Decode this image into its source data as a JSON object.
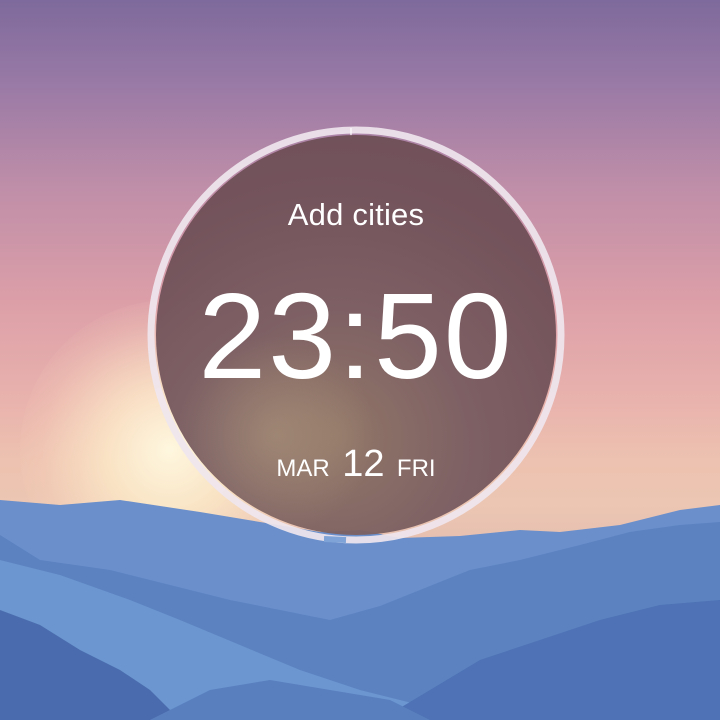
{
  "clock": {
    "add_cities_label": "Add cities",
    "time": "23:50",
    "date": {
      "month": "MAR",
      "day": "12",
      "weekday": "FRI"
    },
    "ring_color": "#ede6ef"
  },
  "wallpaper": {
    "sky_top": "#7e6a9c",
    "sky_mid": "#dc9fa8",
    "sky_horizon": "#edc2b0",
    "mountain_colors": [
      "#4f73b5",
      "#5d84c2",
      "#6b93cc",
      "#4a6cb0"
    ]
  },
  "icons": [
    "sun-glow",
    "mountain-range"
  ]
}
